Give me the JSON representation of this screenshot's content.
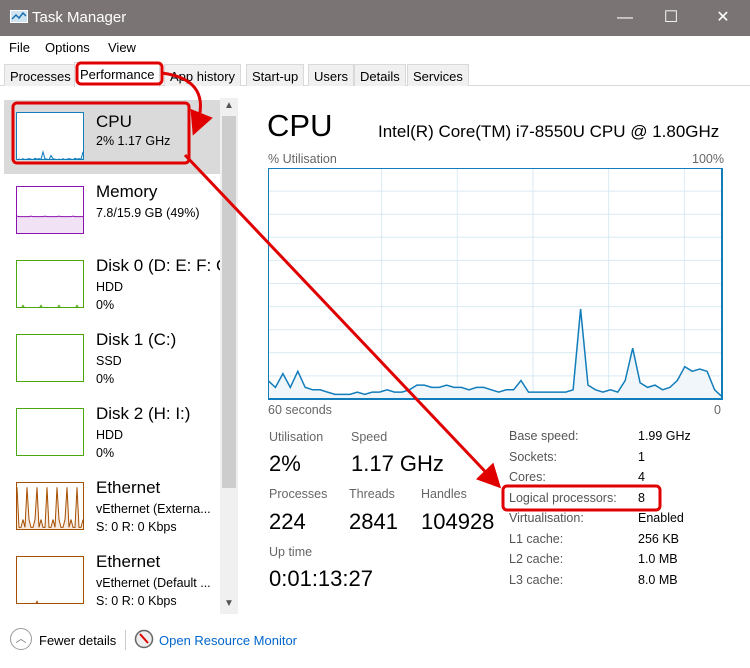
{
  "window": {
    "title": "Task Manager",
    "minimize": "—",
    "maximize": "☐",
    "close": "✕"
  },
  "menu": [
    "File",
    "Options",
    "View"
  ],
  "tabs": [
    "Processes",
    "Performance",
    "App history",
    "Start-up",
    "Users",
    "Details",
    "Services"
  ],
  "active_tab": "Performance",
  "sidebar": {
    "items": [
      {
        "name": "CPU",
        "line1": "2% 1.17 GHz",
        "line2": "",
        "color": "#117dbb",
        "selected": true
      },
      {
        "name": "Memory",
        "line1": "7.8/15.9 GB (49%)",
        "line2": "",
        "color": "#8b12ae"
      },
      {
        "name": "Disk 0 (D: E: F: G",
        "line1": "HDD",
        "line2": "0%",
        "color": "#4da60c"
      },
      {
        "name": "Disk 1 (C:)",
        "line1": "SSD",
        "line2": "0%",
        "color": "#4da60c"
      },
      {
        "name": "Disk 2 (H: I:)",
        "line1": "HDD",
        "line2": "0%",
        "color": "#4da60c"
      },
      {
        "name": "Ethernet",
        "line1": "vEthernet (Externa...",
        "line2": "S: 0 R: 0 Kbps",
        "color": "#a74f01"
      },
      {
        "name": "Ethernet",
        "line1": "vEthernet (Default ...",
        "line2": "S: 0 R: 0 Kbps",
        "color": "#a74f01"
      }
    ]
  },
  "main": {
    "title": "CPU",
    "model": "Intel(R) Core(TM) i7-8550U CPU @ 1.80GHz",
    "graph_label_left": "% Utilisation",
    "graph_label_right": "100%",
    "graph_bottom_left": "60 seconds",
    "graph_bottom_right": "0",
    "stats": {
      "utilisation_label": "Utilisation",
      "utilisation": "2%",
      "speed_label": "Speed",
      "speed": "1.17 GHz",
      "processes_label": "Processes",
      "processes": "224",
      "threads_label": "Threads",
      "threads": "2841",
      "handles_label": "Handles",
      "handles": "104928",
      "uptime_label": "Up time",
      "uptime": "0:01:13:27"
    },
    "details": [
      {
        "k": "Base speed:",
        "v": "1.99 GHz"
      },
      {
        "k": "Sockets:",
        "v": "1"
      },
      {
        "k": "Cores:",
        "v": "4"
      },
      {
        "k": "Logical processors:",
        "v": "8"
      },
      {
        "k": "Virtualisation:",
        "v": "Enabled"
      },
      {
        "k": "L1 cache:",
        "v": "256 KB"
      },
      {
        "k": "L2 cache:",
        "v": "1.0 MB"
      },
      {
        "k": "L3 cache:",
        "v": "8.0 MB"
      }
    ]
  },
  "footer": {
    "fewer_details": "Fewer details",
    "resource_monitor": "Open Resource Monitor"
  },
  "colors": {
    "cpu_line": "#117dbb",
    "cpu_fill": "#f1f6fa",
    "grid": "#d9eaf4",
    "annotation": "#e00000",
    "link": "#0066cc"
  },
  "chart_data": {
    "type": "area",
    "xlabel": "60 seconds",
    "ylim": [
      0,
      100
    ],
    "xlim": [
      60,
      0
    ],
    "values": [
      8,
      5,
      11,
      5,
      12,
      5,
      4,
      4,
      3,
      2,
      2,
      2,
      3,
      2,
      3,
      3,
      4,
      3,
      3,
      4,
      6,
      6,
      5,
      5,
      6,
      5,
      5,
      4,
      5,
      5,
      4,
      3,
      4,
      4,
      8,
      3,
      3,
      3,
      3,
      3,
      3,
      4,
      39,
      6,
      4,
      3,
      4,
      3,
      8,
      22,
      7,
      5,
      6,
      4,
      5,
      8,
      14,
      12,
      13,
      12,
      4,
      1
    ]
  }
}
